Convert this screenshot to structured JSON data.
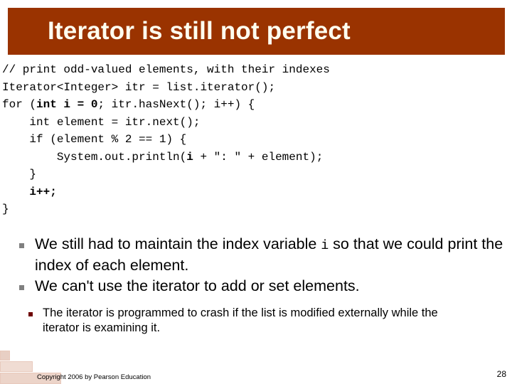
{
  "slide": {
    "title": "Iterator is still not perfect",
    "title_banner_color": "#9a3300",
    "title_text_color": "#fffff0",
    "page_number": "28",
    "copyright": "Copyright 2006 by Pearson Education"
  },
  "code": {
    "language": "java",
    "lines": [
      {
        "id": "line-1",
        "segments": [
          {
            "text": "// print odd-valued elements, with their indexes",
            "bold": false
          }
        ]
      },
      {
        "id": "line-2",
        "segments": [
          {
            "text": "Iterator<Integer> itr = list.iterator();",
            "bold": false
          }
        ]
      },
      {
        "id": "line-3",
        "segments": [
          {
            "text": "for (",
            "bold": false
          },
          {
            "text": "int i = 0",
            "bold": true
          },
          {
            "text": "; itr.hasNext(); i++) {",
            "bold": false
          }
        ]
      },
      {
        "id": "line-4",
        "segments": [
          {
            "text": "    int element = itr.next();",
            "bold": false
          }
        ]
      },
      {
        "id": "line-5",
        "segments": [
          {
            "text": "    if (element % 2 == 1) {",
            "bold": false
          }
        ]
      },
      {
        "id": "line-6",
        "segments": [
          {
            "text": "        System.out.println(",
            "bold": false
          },
          {
            "text": "i",
            "bold": true
          },
          {
            "text": " + \": \" + element);",
            "bold": false
          }
        ]
      },
      {
        "id": "line-7",
        "segments": [
          {
            "text": "    }",
            "bold": false
          }
        ]
      },
      {
        "id": "line-8",
        "segments": [
          {
            "text": "    ",
            "bold": false
          },
          {
            "text": "i++;",
            "bold": true
          }
        ]
      },
      {
        "id": "line-9",
        "segments": [
          {
            "text": "}",
            "bold": false
          }
        ]
      }
    ]
  },
  "bullets": {
    "marker_color": "#808080",
    "items": [
      {
        "id": "bullet-index-variable",
        "segments": [
          {
            "text": "We still had to maintain the index variable ",
            "mono": false
          },
          {
            "text": "i",
            "mono": true
          },
          {
            "text": " so that we could print the index of each element.",
            "mono": false
          }
        ]
      },
      {
        "id": "bullet-add-set",
        "segments": [
          {
            "text": "We can't use the iterator to add or set elements.",
            "mono": false
          }
        ]
      }
    ]
  },
  "subbullets": {
    "marker_color": "#6e0000",
    "items": [
      {
        "id": "subbullet-crash",
        "text": "The iterator is programmed to crash if the list is modified externally while the iterator is examining it."
      }
    ]
  }
}
